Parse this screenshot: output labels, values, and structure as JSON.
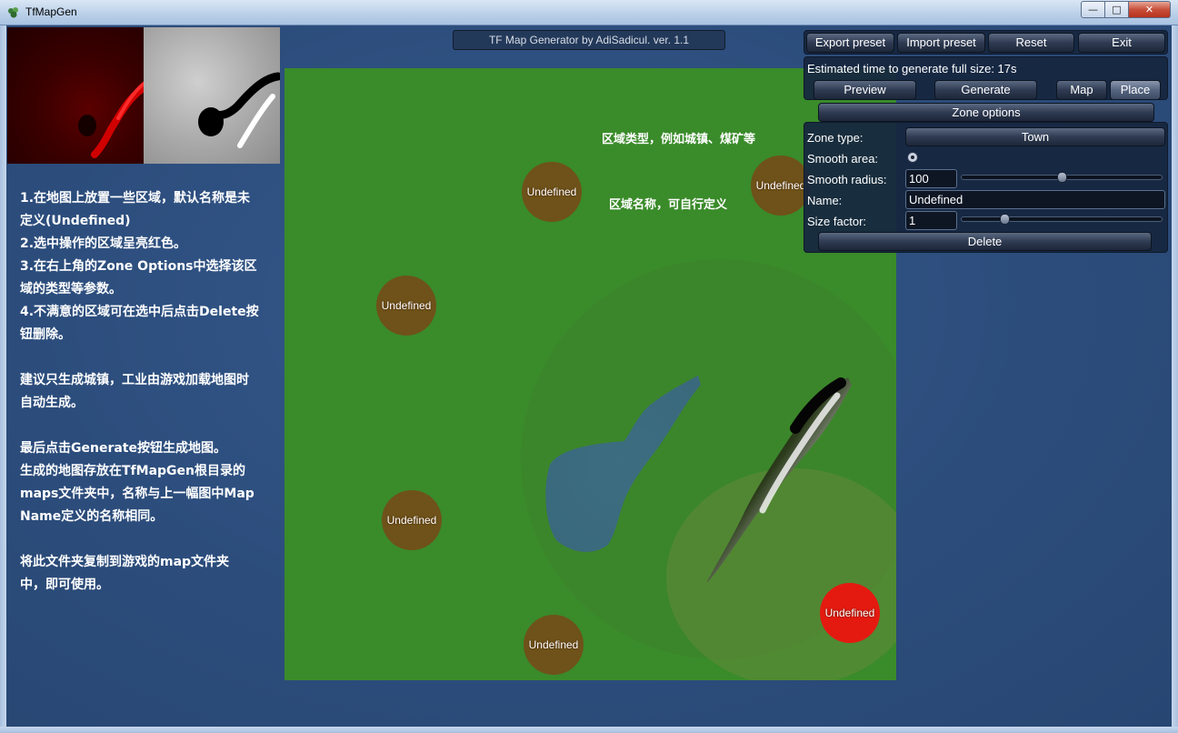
{
  "window": {
    "title": "TfMapGen",
    "minimize_glyph": "—",
    "maximize_glyph": "□",
    "close_glyph": "✕"
  },
  "header": {
    "app_title": "TF Map Generator by AdiSadicul. ver. 1.1"
  },
  "instructions": {
    "step1": "1.在地图上放置一些区域，默认名称是未\n定义(Undefined)",
    "step2": "2.选中操作的区域呈亮红色。",
    "step3": "3.在右上角的Zone Options中选择该区\n域的类型等参数。",
    "step4": "4.不满意的区域可在选中后点击Delete按\n钮删除。",
    "tip": "建议只生成城镇，工业由游戏加载地图时\n自动生成。",
    "final": "最后点击Generate按钮生成地图。\n生成的地图存放在TfMapGen根目录的\nmaps文件夹中，名称与上一幅图中Map\nName定义的名称相同。",
    "copy": "将此文件夹复制到游戏的map文件夹\n中，即可使用。"
  },
  "annotations": {
    "zone_type_note": "区域类型，例如城镇、煤矿等",
    "zone_name_note": "区域名称，可自行定义"
  },
  "zones": [
    {
      "label": "Undefined",
      "selected": false
    },
    {
      "label": "Undefined",
      "selected": false
    },
    {
      "label": "Undefined",
      "selected": false
    },
    {
      "label": "Undefined",
      "selected": false
    },
    {
      "label": "Undefined",
      "selected": false
    },
    {
      "label": "Undefined",
      "selected": true
    }
  ],
  "toolbar": {
    "export_preset": "Export preset",
    "import_preset": "Import preset",
    "reset": "Reset",
    "exit": "Exit"
  },
  "generate_panel": {
    "estimate": "Estimated time to generate full size: 17s",
    "preview": "Preview",
    "generate": "Generate",
    "map": "Map",
    "place": "Place"
  },
  "zone_options": {
    "header_button": "Zone options",
    "zone_type_label": "Zone type:",
    "zone_type_value": "Town",
    "smooth_area_label": "Smooth area:",
    "smooth_radius_label": "Smooth radius:",
    "smooth_radius_value": "100",
    "smooth_radius_level": 0.5,
    "name_label": "Name:",
    "name_value": "Undefined",
    "size_factor_label": "Size factor:",
    "size_factor_value": "1",
    "size_factor_level": 0.2,
    "delete": "Delete"
  },
  "colors": {
    "background": "#2d4f80",
    "map_green": "#3c8b2b",
    "zone_fill": "#823c14",
    "zone_selected": "#e41a10",
    "panel": "#16263e"
  }
}
